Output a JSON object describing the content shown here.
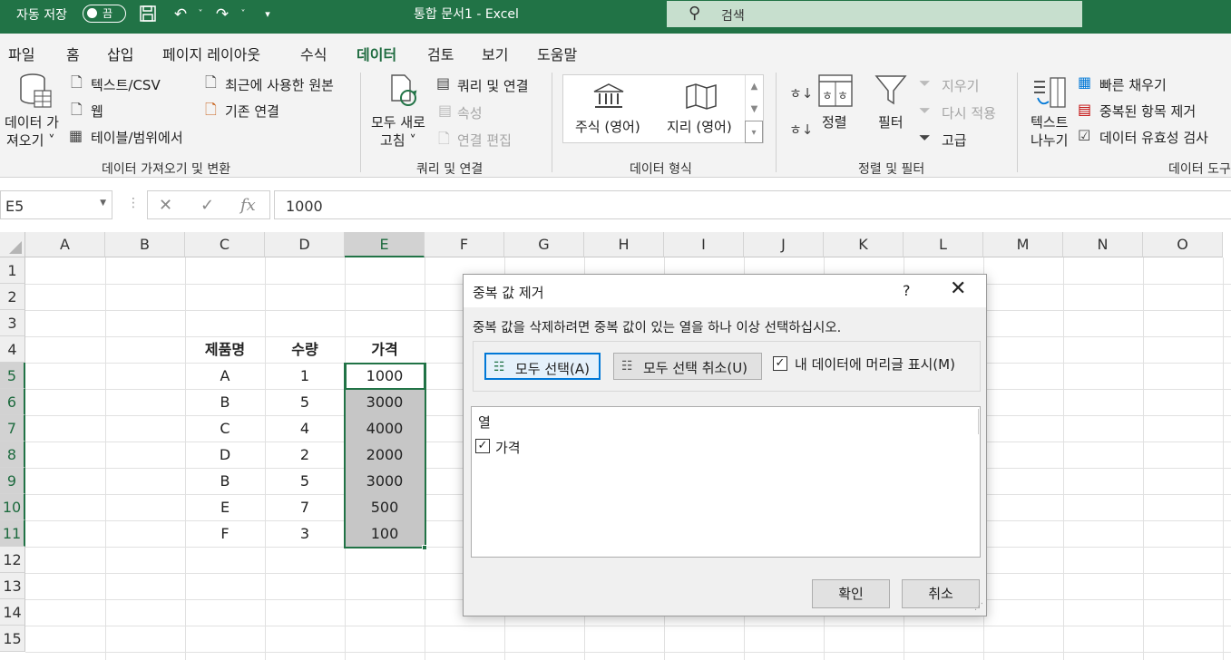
{
  "titlebar": {
    "autosave_label": "자동 저장",
    "autosave_state": "끔",
    "doc_title": "통합 문서1  -  Excel",
    "search_placeholder": "검색"
  },
  "menu_tabs": [
    "파일",
    "홈",
    "삽입",
    "페이지 레이아웃",
    "수식",
    "데이터",
    "검토",
    "보기",
    "도움말"
  ],
  "active_tab": "데이터",
  "ribbon": {
    "get_data": {
      "big_button": [
        "데이터 가",
        "져오기 ˅"
      ],
      "text_csv": "텍스트/CSV",
      "web": "웹",
      "table_range": "테이블/범위에서",
      "recent_sources": "최근에 사용한 원본",
      "existing_connections": "기존 연결",
      "group_title": "데이터 가져오기 및 변환"
    },
    "queries": {
      "refresh_all": [
        "모두 새로",
        "고침 ˅"
      ],
      "queries_connections": "쿼리 및 연결",
      "properties": "속성",
      "edit_links": "연결 편집",
      "group_title": "쿼리 및 연결"
    },
    "data_types": {
      "stocks": "주식 (영어)",
      "geography": "지리 (영어)",
      "group_title": "데이터 형식"
    },
    "sort_filter": {
      "sort": "정렬",
      "filter": "필터",
      "clear": "지우기",
      "reapply": "다시 적용",
      "advanced": "고급",
      "group_title": "정렬 및 필터"
    },
    "data_tools": {
      "text_to_columns": [
        "텍스트",
        "나누기"
      ],
      "flash_fill": "빠른 채우기",
      "remove_duplicates": "중복된 항목 제거",
      "data_validation": "데이터 유효성 검사",
      "group_title": "데이터 도구"
    }
  },
  "formula_bar": {
    "name_box": "E5",
    "formula": "1000"
  },
  "columns": [
    "A",
    "B",
    "C",
    "D",
    "E",
    "F",
    "G",
    "H",
    "I",
    "J",
    "K",
    "L",
    "M",
    "N",
    "O"
  ],
  "rows": [
    "1",
    "2",
    "3",
    "4",
    "5",
    "6",
    "7",
    "8",
    "9",
    "10",
    "11",
    "12",
    "13",
    "14",
    "15"
  ],
  "table": {
    "headers": [
      "제품명",
      "수량",
      "가격"
    ],
    "data": [
      [
        "A",
        "1",
        "1000"
      ],
      [
        "B",
        "5",
        "3000"
      ],
      [
        "C",
        "4",
        "4000"
      ],
      [
        "D",
        "2",
        "2000"
      ],
      [
        "B",
        "5",
        "3000"
      ],
      [
        "E",
        "7",
        "500"
      ],
      [
        "F",
        "3",
        "100"
      ]
    ]
  },
  "dialog": {
    "title": "중복 값 제거",
    "help": "?",
    "message": "중복 값을 삭제하려면 중복 값이 있는 열을 하나 이상 선택하십시오.",
    "select_all": "모두 선택(A)",
    "unselect_all": "모두 선택 취소(U)",
    "my_data_has_headers": "내 데이터에 머리글 표시(M)",
    "headers_checked": true,
    "list_header": "열",
    "columns": [
      {
        "label": "가격",
        "checked": true
      }
    ],
    "ok": "확인",
    "cancel": "취소"
  },
  "colors": {
    "excel_green": "#217346",
    "selection_shade": "#c6c6c6",
    "ribbon_bg": "#f3f3f3"
  }
}
